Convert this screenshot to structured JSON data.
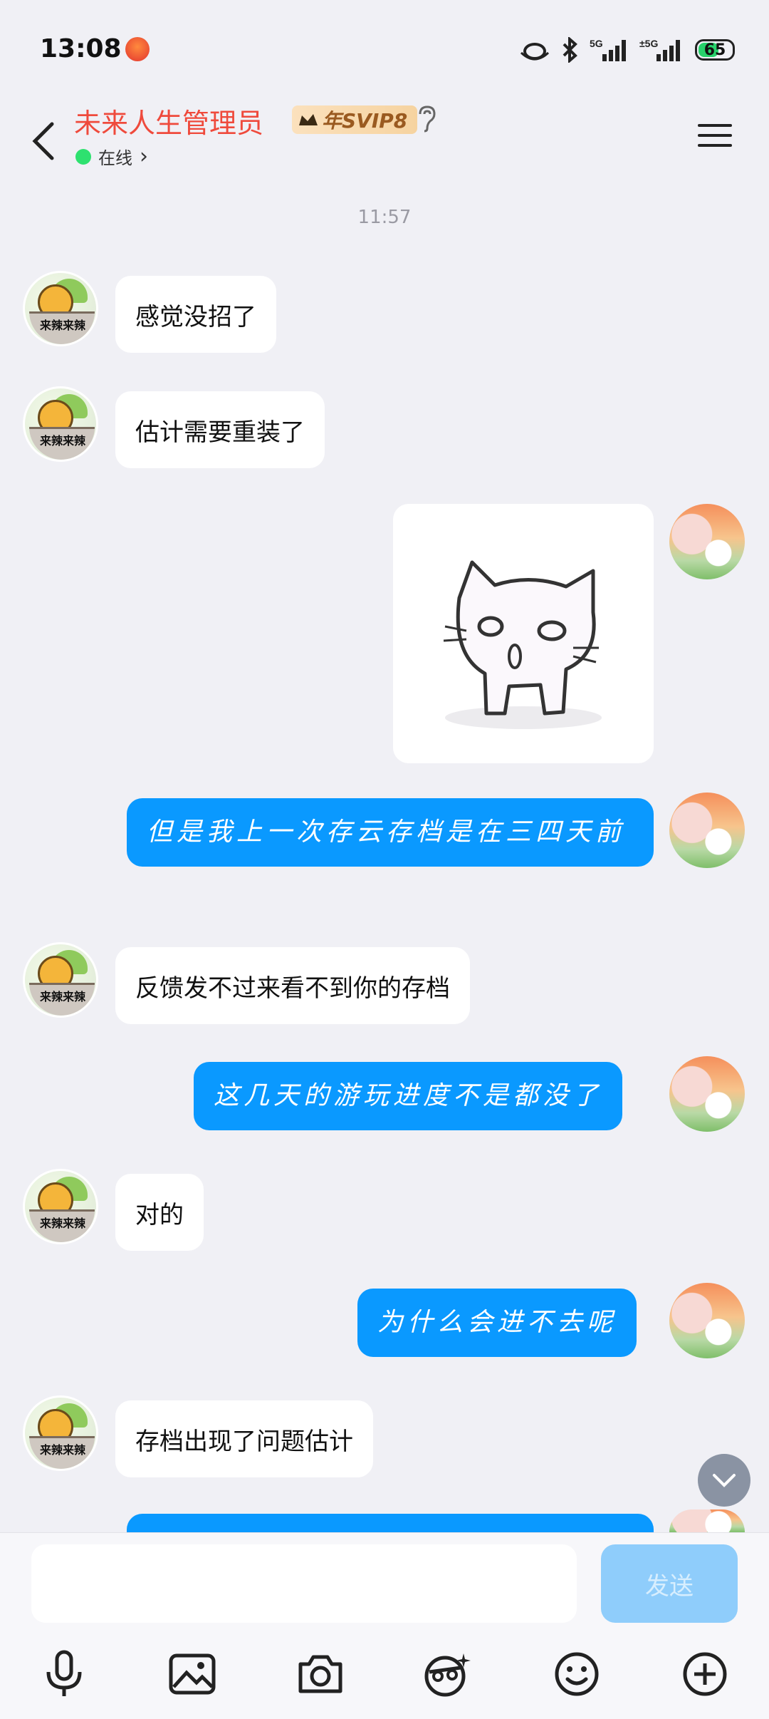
{
  "status_bar": {
    "time": "13:08",
    "battery": "65",
    "network": "5G"
  },
  "header": {
    "title": "未来人生管理员",
    "vip_badge": "年SVIP8",
    "online_status": "在线",
    "online_chevron": "›"
  },
  "chat": {
    "timestamp": "11:57",
    "messages": [
      {
        "side": "left",
        "text": "感觉没招了"
      },
      {
        "side": "left",
        "text": "估计需要重装了"
      },
      {
        "side": "right",
        "type": "sticker",
        "icon": "cat-sticker"
      },
      {
        "side": "right",
        "text": "但是我上一次存云存档是在三四天前"
      },
      {
        "side": "left",
        "text": "反馈发不过来看不到你的存档"
      },
      {
        "side": "right",
        "text": "这几天的游玩进度不是都没了"
      },
      {
        "side": "left",
        "text": "对的"
      },
      {
        "side": "right",
        "text": "为什么会进不去呢"
      },
      {
        "side": "left",
        "text": "存档出现了问题估计"
      }
    ],
    "avatar_label": "来辣来辣"
  },
  "composer": {
    "input_value": "",
    "input_placeholder": "",
    "send_label": "发送"
  },
  "toolbar": {
    "icons": [
      "microphone-icon",
      "image-icon",
      "camera-icon",
      "face-effect-icon",
      "emoji-icon",
      "plus-icon"
    ]
  },
  "colors": {
    "accent": "#0a99ff",
    "title": "#ef4a3c",
    "background": "#f0f0f5"
  }
}
